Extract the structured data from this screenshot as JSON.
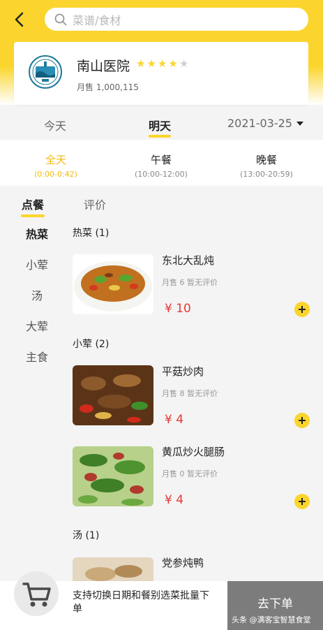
{
  "search": {
    "placeholder": "菜谱/食材"
  },
  "shop": {
    "name": "南山医院",
    "rating": 4,
    "rating_max": 5,
    "monthly_sales": "月售 1,000,115"
  },
  "dates": {
    "tabs": [
      "今天",
      "明天"
    ],
    "selected_date": "2021-03-25"
  },
  "meals": [
    {
      "name": "全天",
      "time": "(0:00-0:42)"
    },
    {
      "name": "午餐",
      "time": "(10:00-12:00)"
    },
    {
      "name": "晚餐",
      "time": "(13:00-20:59)"
    }
  ],
  "sub_tabs": [
    "点餐",
    "评价"
  ],
  "categories": [
    "热菜",
    "小荤",
    "汤",
    "大荤",
    "主食"
  ],
  "sections": [
    {
      "title": "热菜 (1)"
    },
    {
      "title": "小荤 (2)"
    },
    {
      "title": "汤 (1)"
    }
  ],
  "dishes": [
    {
      "name": "东北大乱炖",
      "meta": "月售 6  暂无评价",
      "price": "¥ 10"
    },
    {
      "name": "平菇炒肉",
      "meta": "月售 8  暂无评价",
      "price": "¥ 4"
    },
    {
      "name": "黄瓜炒火腿肠",
      "meta": "月售 0  暂无评价",
      "price": "¥ 4"
    },
    {
      "name": "党参炖鸭",
      "meta": "",
      "price": ""
    }
  ],
  "bottom": {
    "hint": "支持切换日期和餐别选菜批量下单",
    "checkout": "去下单",
    "watermark": "头条 @满客宝智慧食堂"
  },
  "colors": {
    "accent": "#fbd52d",
    "price": "#e53935",
    "active_meal": "#f2b90c"
  },
  "icons": [
    "back-arrow-icon",
    "search-icon",
    "star-icon",
    "caret-down-icon",
    "add-icon",
    "cart-icon"
  ]
}
